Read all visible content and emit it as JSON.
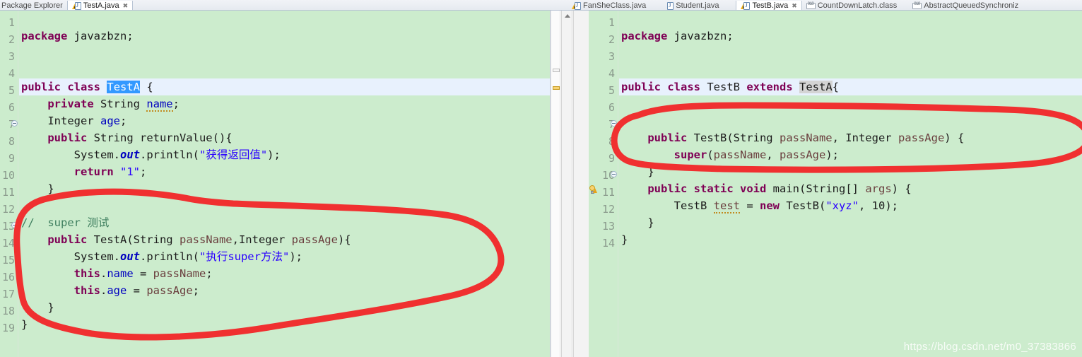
{
  "window": {
    "left_tabs": [
      {
        "label": "Package Explorer",
        "icon": "package-explorer-icon",
        "active": false,
        "closable": false
      },
      {
        "label": "TestA.java",
        "icon": "java-warning-icon",
        "active": true,
        "closable": true
      }
    ],
    "right_tabs": [
      {
        "label": "FanSheClass.java",
        "icon": "java-warning-icon",
        "active": false,
        "closable": false
      },
      {
        "label": "Student.java",
        "icon": "java-icon",
        "active": false,
        "closable": false
      },
      {
        "label": "TestB.java",
        "icon": "java-warning-icon",
        "active": true,
        "closable": true
      },
      {
        "label": "CountDownLatch.class",
        "icon": "class-file-icon",
        "active": false,
        "closable": false
      },
      {
        "label": "AbstractQueuedSynchroniz",
        "icon": "class-file-icon",
        "active": false,
        "closable": false
      }
    ]
  },
  "editor_left": {
    "file": "TestA.java",
    "current_line": 4,
    "selected_token": "TestA",
    "line_numbers": [
      1,
      2,
      3,
      4,
      5,
      6,
      7,
      8,
      9,
      10,
      11,
      12,
      13,
      14,
      15,
      16,
      17,
      18,
      19
    ],
    "fold_markers": [
      7,
      13
    ],
    "lines": [
      "package javazbzn;",
      "",
      "",
      "public class TestA {",
      "    private String name;",
      "    Integer age;",
      "    public String returnValue(){",
      "        System.out.println(\"获得返回值\");",
      "        return \"1\";",
      "    }",
      "",
      "//  super 测试",
      "    public TestA(String passName,Integer passAge){",
      "        System.out.println(\"执行super方法\");",
      "        this.name = passName;",
      "        this.age = passAge;",
      "    }",
      "}",
      ""
    ]
  },
  "editor_right": {
    "file": "TestB.java",
    "current_line": 4,
    "occurrence_token": "TestA",
    "warning_line": 11,
    "line_numbers": [
      1,
      2,
      3,
      4,
      5,
      6,
      7,
      8,
      9,
      10,
      11,
      12,
      13,
      14
    ],
    "fold_markers": [
      7,
      10
    ],
    "lines": [
      "package javazbzn;",
      "",
      "",
      "public class TestB extends TestA{",
      "",
      "",
      "    public TestB(String passName, Integer passAge) {",
      "        super(passName, passAge);",
      "    }",
      "    public static void main(String[] args) {",
      "        TestB test = new TestB(\"xyz\", 10);",
      "    }",
      "}",
      ""
    ]
  },
  "annotations": {
    "color": "#f03030",
    "shapes": [
      {
        "name": "left-constructor-circle",
        "target_lines": "12-18",
        "panel": "left"
      },
      {
        "name": "right-constructor-circle",
        "target_lines": "7-9",
        "panel": "right"
      }
    ]
  },
  "watermark": {
    "text": "https://blog.csdn.net/m0_37383866"
  },
  "colors": {
    "editor_background": "#cceccd",
    "current_line": "#e8f1fd",
    "selection": "#3399ff",
    "occurrence": "#d4d4d4",
    "keyword": "#7f0055",
    "string": "#2a00ff",
    "comment": "#3f7f5f",
    "field": "#0000c0",
    "local_variable": "#6a3e3e",
    "line_number": "#8a9a8c",
    "annotation_red": "#f03030"
  }
}
